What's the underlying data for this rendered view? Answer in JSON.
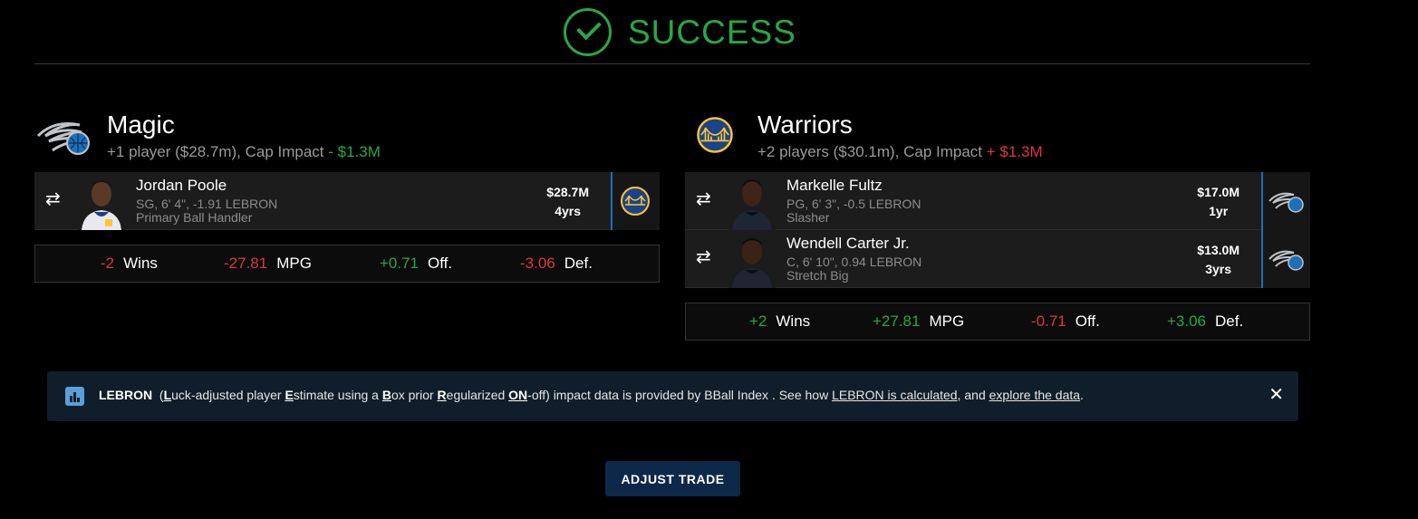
{
  "status": {
    "text": "SUCCESS",
    "color": "#28a745"
  },
  "teams": [
    {
      "name": "Magic",
      "summary": "+1 player ($28.7m), Cap Impact",
      "cap_impact": "- $1.3M",
      "cap_color": "#28a745",
      "logo_icon": "magic-logo-icon",
      "players": [
        {
          "name": "Jordan Poole",
          "line1": "SG, 6' 4\", -1.91 LEBRON",
          "line2": "Primary Ball Handler",
          "salary": "$28.7M",
          "years": "4yrs",
          "destination_icon": "warriors-logo-icon"
        }
      ],
      "impact": [
        {
          "value": "-2",
          "label": "Wins"
        },
        {
          "value": "-27.81",
          "label": "MPG"
        },
        {
          "value": "+0.71",
          "label": "Off."
        },
        {
          "value": "-3.06",
          "label": "Def."
        }
      ]
    },
    {
      "name": "Warriors",
      "summary": "+2 players ($30.1m), Cap Impact",
      "cap_impact": "+ $1.3M",
      "cap_color": "#dc3545",
      "logo_icon": "warriors-logo-icon",
      "players": [
        {
          "name": "Markelle Fultz",
          "line1": "PG, 6' 3\", -0.5 LEBRON",
          "line2": "Slasher",
          "salary": "$17.0M",
          "years": "1yr",
          "destination_icon": "magic-logo-icon"
        },
        {
          "name": "Wendell Carter Jr.",
          "line1": "C, 6' 10\", 0.94 LEBRON",
          "line2": "Stretch Big",
          "salary": "$13.0M",
          "years": "3yrs",
          "destination_icon": "magic-logo-icon"
        }
      ],
      "impact": [
        {
          "value": "+2",
          "label": "Wins"
        },
        {
          "value": "+27.81",
          "label": "MPG"
        },
        {
          "value": "-0.71",
          "label": "Off."
        },
        {
          "value": "+3.06",
          "label": "Def."
        }
      ]
    }
  ],
  "banner": {
    "lebron": "LEBRON",
    "p1": "(",
    "L": "L",
    "p2": "uck-adjusted player ",
    "E": "E",
    "p3": "stimate using a ",
    "B": "B",
    "p4": "ox prior ",
    "R": "R",
    "p5": "egularized ",
    "ON": "ON",
    "p6": "-off) impact data is provided by BBall Index . See how ",
    "link1": "LEBRON is calculated",
    "p7": ", and ",
    "link2": "explore the data",
    "p8": "."
  },
  "adjust_button": "ADJUST TRADE",
  "colors": {
    "positive": "#28a745",
    "negative": "#dc3545",
    "accent": "#1e6fb8",
    "button": "#0d2849"
  }
}
